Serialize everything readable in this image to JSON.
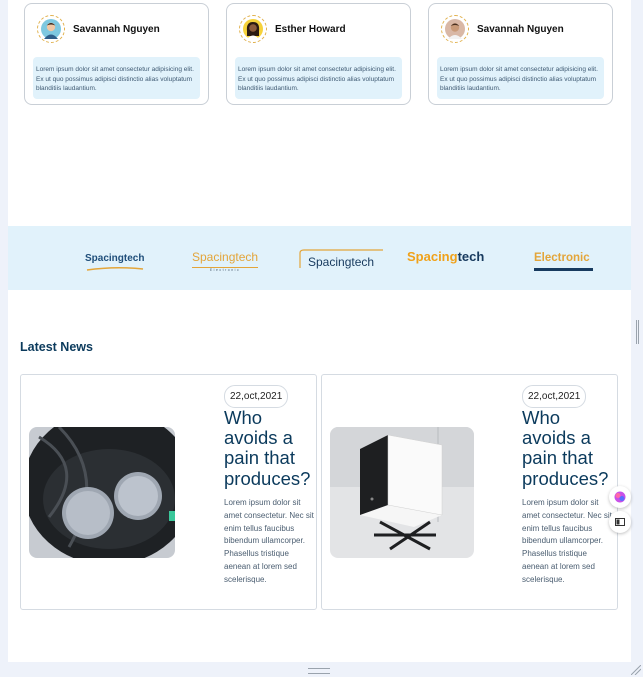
{
  "testimonials": [
    {
      "name": "Savannah Nguyen",
      "avatar_icon": "avatar-man-icon",
      "text": "Lorem ipsum dolor sit amet consectetur adipisicing elit. Ex ut quo possimus adipisci distinctio alias voluptatum blanditiis laudantium."
    },
    {
      "name": "Esther Howard",
      "avatar_icon": "avatar-woman-icon",
      "text": "Lorem ipsum dolor sit amet consectetur adipisicing elit. Ex ut quo possimus adipisci distinctio alias voluptatum blanditiis laudantium."
    },
    {
      "name": "Savannah Nguyen",
      "avatar_icon": "avatar-man-icon",
      "text": "Lorem ipsum dolor sit amet consectetur adipisicing elit. Ex ut quo possimus adipisci distinctio alias voluptatum blanditiis laudantium."
    }
  ],
  "brands": [
    {
      "name": "Spacingtech",
      "color": "#1f4e7a"
    },
    {
      "name": "Spacingtech",
      "sub": "Electronic",
      "color": "#e3a53a"
    },
    {
      "name": "Spacingtech",
      "color": "#173a5e"
    },
    {
      "name": "Spacing",
      "suffix": "tech",
      "color": "#f0a21a",
      "suffix_color": "#173a5e"
    },
    {
      "name": "Electronic",
      "color": "#e3a53a"
    }
  ],
  "news": {
    "heading": "Latest News",
    "items": [
      {
        "date": "22,oct,2021",
        "title": "Who avoids a pain that produces?",
        "text": "Lorem ipsum dolor sit amet consectetur. Nec sit enim tellus faucibus bibendum ullamcorper. Phasellus tristique aenean at lorem sed scelerisque.",
        "image_icon": "earbuds-case-photo"
      },
      {
        "date": "22,oct,2021",
        "title": "Who avoids a pain that produces?",
        "text": "Lorem ipsum dolor sit amet consectetur. Nec sit enim tellus faucibus bibendum ullamcorper. Phasellus tristique aenean at lorem sed scelerisque.",
        "image_icon": "mini-pc-photo"
      }
    ]
  },
  "floating": [
    {
      "icon": "assistant-icon"
    },
    {
      "icon": "panel-toggle-icon"
    }
  ]
}
